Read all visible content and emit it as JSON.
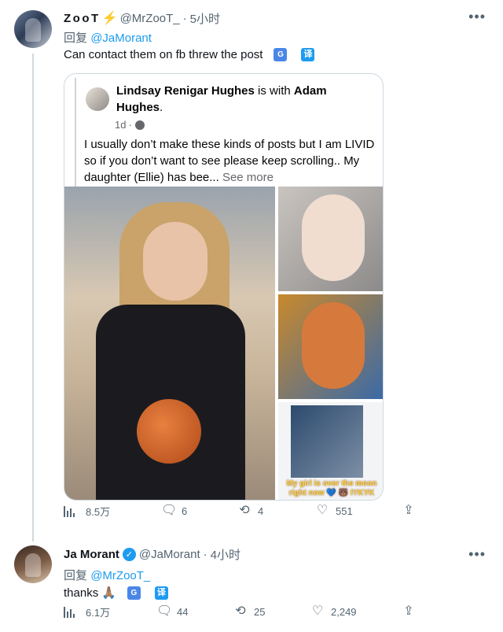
{
  "tweet1": {
    "name": "ZooT",
    "handle": "@MrZooT_",
    "time": "5小时",
    "reply_prefix": "回复",
    "reply_mention": "@JaMorant",
    "text": "Can contact them on fb threw the post",
    "translate_label": "译",
    "stats": {
      "views": "8.5万",
      "replies": "6",
      "retweets": "4",
      "likes": "551"
    },
    "quote": {
      "author": "Lindsay Renigar Hughes",
      "with_word": "is with",
      "with_name": "Adam Hughes",
      "time": "1d",
      "text": "I usually don’t make these kinds of posts but I am LIVID so if you don’t want to see please keep scrolling.. My daughter (Ellie) has bee...",
      "see_more": "See more",
      "photo_caption": "My girl is over the moon right now 💙 🐻 IYKYK"
    }
  },
  "tweet2": {
    "name": "Ja Morant",
    "handle": "@JaMorant",
    "time": "4小时",
    "reply_prefix": "回复",
    "reply_mention": "@MrZooT_",
    "text": "thanks",
    "emoji": "🙏🏽",
    "translate_label": "译",
    "stats": {
      "views": "6.1万",
      "replies": "44",
      "retweets": "25",
      "likes": "2,249"
    }
  },
  "icons": {
    "more": "more-dots-icon",
    "views": "bar-chart-icon",
    "reply": "speech-bubble-icon",
    "retweet": "retweet-icon",
    "like": "heart-icon",
    "share": "share-icon",
    "verified": "verified-badge-icon",
    "bolt": "lightning-icon",
    "translate": "translate-icon",
    "globe": "globe-icon"
  },
  "colors": {
    "accent": "#1d9bf0",
    "muted": "#536471",
    "bolt": "#f5b400"
  }
}
